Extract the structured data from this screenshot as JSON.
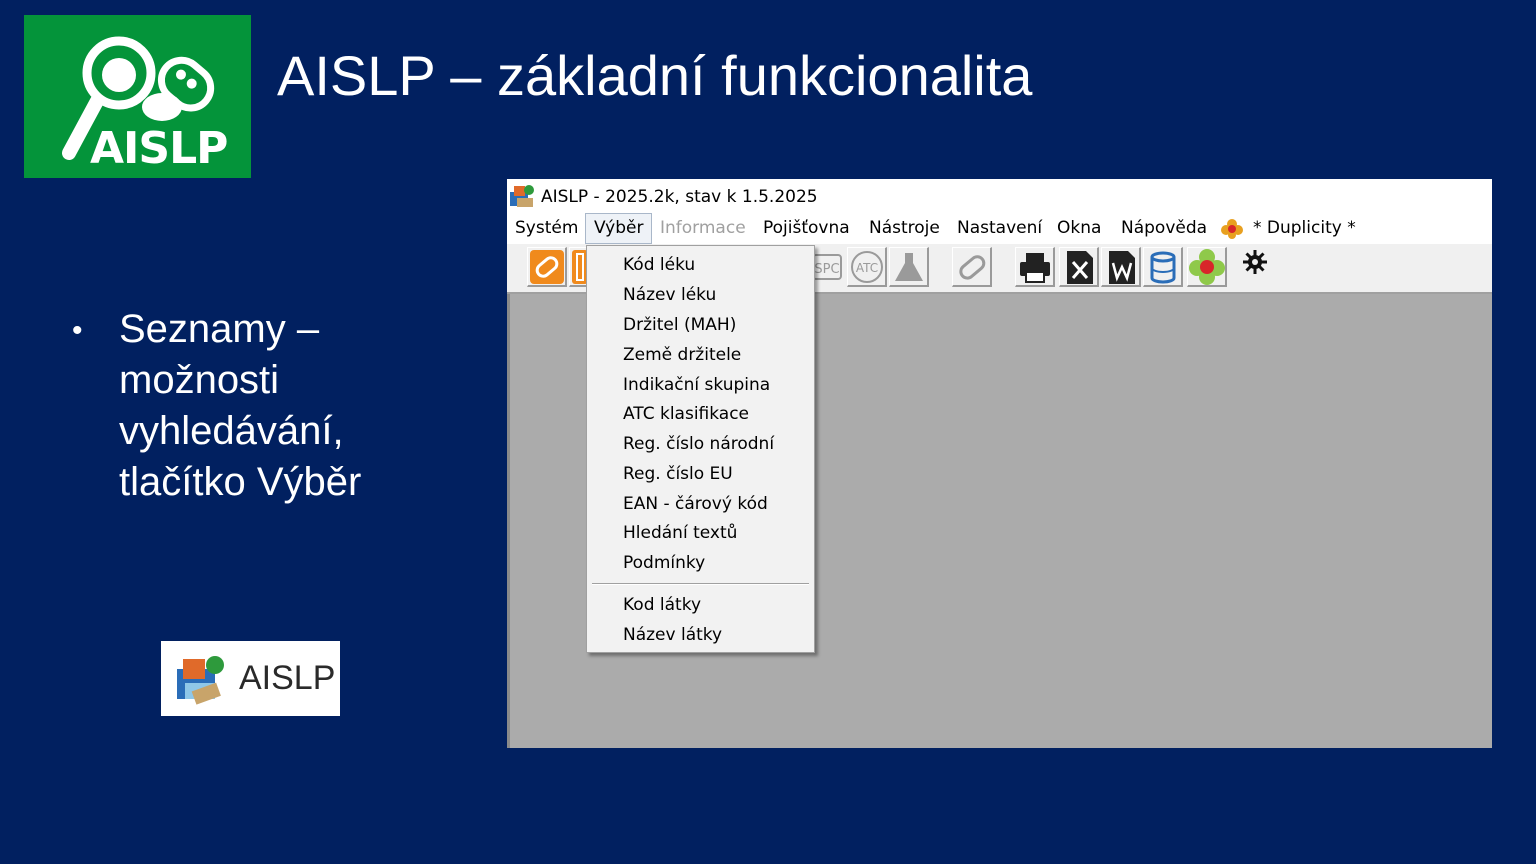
{
  "logo": {
    "text": "AISLP",
    "bg_color": "#04943a"
  },
  "slide": {
    "title": "AISLP – základní funkcionalita",
    "bullet": "Seznamy – možnosti vyhledávání, tlačítko Výběr",
    "icon_badge_text": "AISLP"
  },
  "colors": {
    "slide_bg": "#012060",
    "workspace": "#ababab",
    "accent_orange": "#f08a1c"
  },
  "window": {
    "title": "AISLP - 2025.2k, stav k 1.5.2025",
    "menu": [
      {
        "label": "Systém",
        "state": "normal"
      },
      {
        "label": "Výběr",
        "state": "open"
      },
      {
        "label": "Informace",
        "state": "disabled"
      },
      {
        "label": "Pojišťovna",
        "state": "normal"
      },
      {
        "label": "Nástroje",
        "state": "normal"
      },
      {
        "label": "Nastavení",
        "state": "normal"
      },
      {
        "label": "Okna",
        "state": "normal"
      },
      {
        "label": "Nápověda",
        "state": "normal"
      },
      {
        "label": "* Duplicity *",
        "state": "normal"
      }
    ],
    "toolbar_icons": [
      "pill-icon",
      "key-icon",
      "spc-icon",
      "atc-icon",
      "flask-icon",
      "pill-gray-icon",
      "printer-icon",
      "excel-icon",
      "word-icon",
      "database-icon",
      "flower-icon",
      "gear-icon"
    ],
    "toolbar_labels": {
      "spc": "SPC",
      "atc": "ATC"
    },
    "dropdown": {
      "items": [
        "Kód léku",
        "Název léku",
        "Držitel (MAH)",
        "Země držitele",
        "Indikační skupina",
        "ATC klasifikace",
        "Reg. číslo národní",
        "Reg. číslo EU",
        "EAN - čárový kód",
        "Hledání textů",
        "Podmínky"
      ],
      "items_after_separator": [
        "Kod látky",
        "Název látky"
      ]
    }
  }
}
